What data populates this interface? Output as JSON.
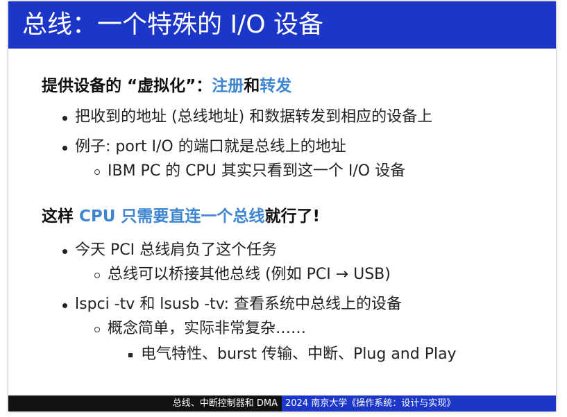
{
  "title": "总线：一个特殊的 I/O 设备",
  "section1": {
    "heading_prefix": "提供设备的 “虚拟化”：",
    "heading_hl1": "注册",
    "heading_mid": "和",
    "heading_hl2": "转发",
    "items": [
      "把收到的地址 (总线地址) 和数据转发到相应的设备上",
      "例子: port I/O 的端口就是总线上的地址"
    ],
    "subitem": "IBM PC 的 CPU 其实只看到这一个 I/O 设备"
  },
  "section2": {
    "heading_prefix": "这样 ",
    "heading_hl": "CPU 只需要直连一个总线",
    "heading_suffix": "就行了!",
    "item1": "今天 PCI 总线肩负了这个任务",
    "item1_sub": "总线可以桥接其他总线 (例如 PCI → USB)",
    "item2": "lspci -tv 和 lsusb -tv: 查看系统中总线上的设备",
    "item2_sub": "概念简单，实际非常复杂……",
    "item2_subsub": "电气特性、burst 传输、中断、Plug and Play"
  },
  "footer": {
    "left": "总线、中断控制器和 DMA",
    "right": "2024 南京大学《操作系统：设计与实现》"
  },
  "colors": {
    "title_bar": "#1c36c8",
    "highlight": "#3f86d0",
    "footer_left": "#111111",
    "footer_right": "#1c36c8"
  }
}
